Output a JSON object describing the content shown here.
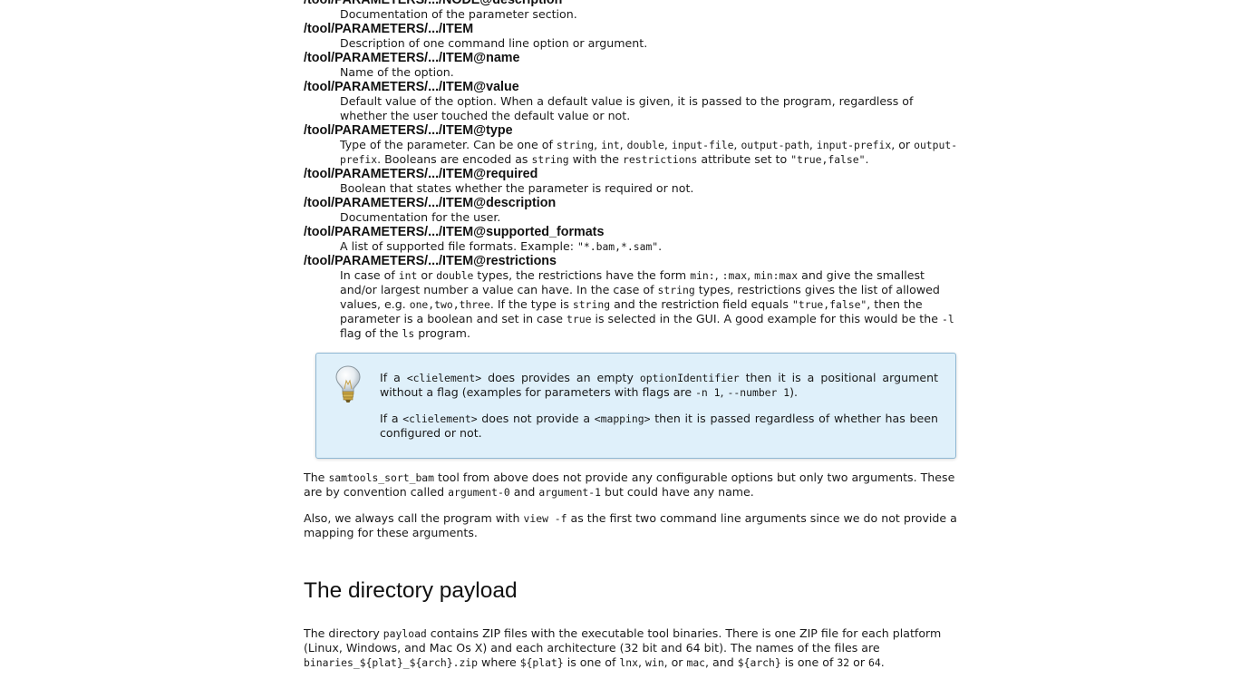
{
  "defs": [
    {
      "term": "/tool/PARAMETERS/.../NODE@description",
      "desc": "Documentation of the parameter section."
    },
    {
      "term": "/tool/PARAMETERS/.../ITEM",
      "desc": "Description of one command line option or argument."
    },
    {
      "term": "/tool/PARAMETERS/.../ITEM@name",
      "desc": "Name of the option."
    },
    {
      "term": "/tool/PARAMETERS/.../ITEM@value",
      "desc": "Default value of the option. When a default value is given, it is passed to the program, regardless of whether the user touched the default value or not."
    },
    {
      "term": "/tool/PARAMETERS/.../ITEM@type",
      "desc_parts": [
        "Type of the parameter. Can be one of ",
        "string",
        ", ",
        "int",
        ", ",
        "double",
        ", ",
        "input-file",
        ", ",
        "output-path",
        ", ",
        "input-prefix",
        ", or ",
        "output-prefix",
        ". Booleans are encoded as ",
        "string",
        " with the ",
        "restrictions",
        " attribute set to ",
        "\"true,false\"",
        "."
      ]
    },
    {
      "term": "/tool/PARAMETERS/.../ITEM@required",
      "desc": "Boolean that states whether the parameter is required or not."
    },
    {
      "term": "/tool/PARAMETERS/.../ITEM@description",
      "desc": "Documentation for the user."
    },
    {
      "term": "/tool/PARAMETERS/.../ITEM@supported_formats",
      "desc_parts": [
        "A list of supported file formats. Example: ",
        "\"*.bam,*.sam\"",
        "."
      ]
    },
    {
      "term": "/tool/PARAMETERS/.../ITEM@restrictions",
      "desc_parts": [
        "In case of ",
        "int",
        " or ",
        "double",
        " types, the restrictions have the form ",
        "min:",
        ", ",
        ":max",
        ", ",
        "min:max",
        " and give the smallest and/or largest number a value can have. In the case of ",
        "string",
        " types, restrictions gives the list of allowed values, e.g. ",
        "one,two,three",
        ". If the type is ",
        "string",
        " and the restriction field equals ",
        "\"true,false\"",
        ", then the parameter is a boolean and set in case ",
        "true",
        " is selected in the GUI. A good example for this would be the ",
        "-l",
        " flag of the ",
        "ls",
        " program."
      ]
    }
  ],
  "note": {
    "icon": "lightbulb-icon",
    "p1_parts": [
      "If a ",
      "<clielement>",
      " does provides an empty ",
      "optionIdentifier",
      " then it is a positional argument without a flag (examples for parameters with flags are ",
      "-n 1",
      ", ",
      "--number 1",
      ")."
    ],
    "p2_parts": [
      "If a ",
      "<clielement>",
      " does not provide a ",
      "<mapping>",
      " then it is passed regardless of whether has been configured or not."
    ]
  },
  "para1_parts": [
    "The ",
    "samtools_sort_bam",
    " tool from above does not provide any configurable options but only two arguments. These are by convention called ",
    "argument-0",
    " and ",
    "argument-1",
    " but could have any name."
  ],
  "para2_parts": [
    "Also, we always call the program with ",
    "view -f",
    " as the first two command line arguments since we do not provide a mapping for these arguments."
  ],
  "heading": "The directory payload",
  "para3_parts": [
    "The directory ",
    "payload",
    " contains ZIP files with the executable tool binaries. There is one ZIP file for each platform (Linux, Windows, and Mac Os X) and each architecture (32 bit and 64 bit). The names of the files are ",
    "binaries_${plat}_${arch}.zip",
    " where ",
    "${plat}",
    " is one of ",
    "lnx",
    ", ",
    "win",
    ", or ",
    "mac",
    ", and ",
    "${arch}",
    " is one of ",
    "32",
    " or ",
    "64",
    "."
  ],
  "colors": {
    "note_background": "#dff0fa",
    "note_border": "#8fb7d2"
  }
}
